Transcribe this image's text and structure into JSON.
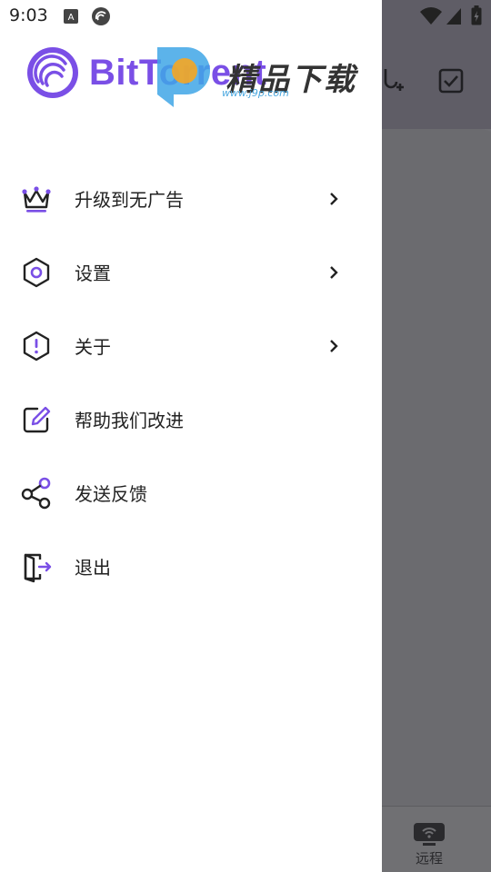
{
  "status_bar": {
    "time": "9:03"
  },
  "drawer": {
    "logo_text": "BitTorrent",
    "menu": [
      {
        "label": "升级到无广告",
        "icon": "crown-icon",
        "has_chevron": true
      },
      {
        "label": "设置",
        "icon": "gear-icon",
        "has_chevron": true
      },
      {
        "label": "关于",
        "icon": "info-hexagon-icon",
        "has_chevron": true
      },
      {
        "label": "帮助我们改进",
        "icon": "edit-icon",
        "has_chevron": false
      },
      {
        "label": "发送反馈",
        "icon": "share-icon",
        "has_chevron": false
      },
      {
        "label": "退出",
        "icon": "exit-icon",
        "has_chevron": false
      }
    ]
  },
  "watermark": {
    "text": "精品下载",
    "url": "www.j9p.com"
  },
  "background_app": {
    "bottom_tab_label": "远程"
  },
  "colors": {
    "accent": "#7a4fe6",
    "text": "#222222",
    "overlay": "#6e6e73"
  }
}
